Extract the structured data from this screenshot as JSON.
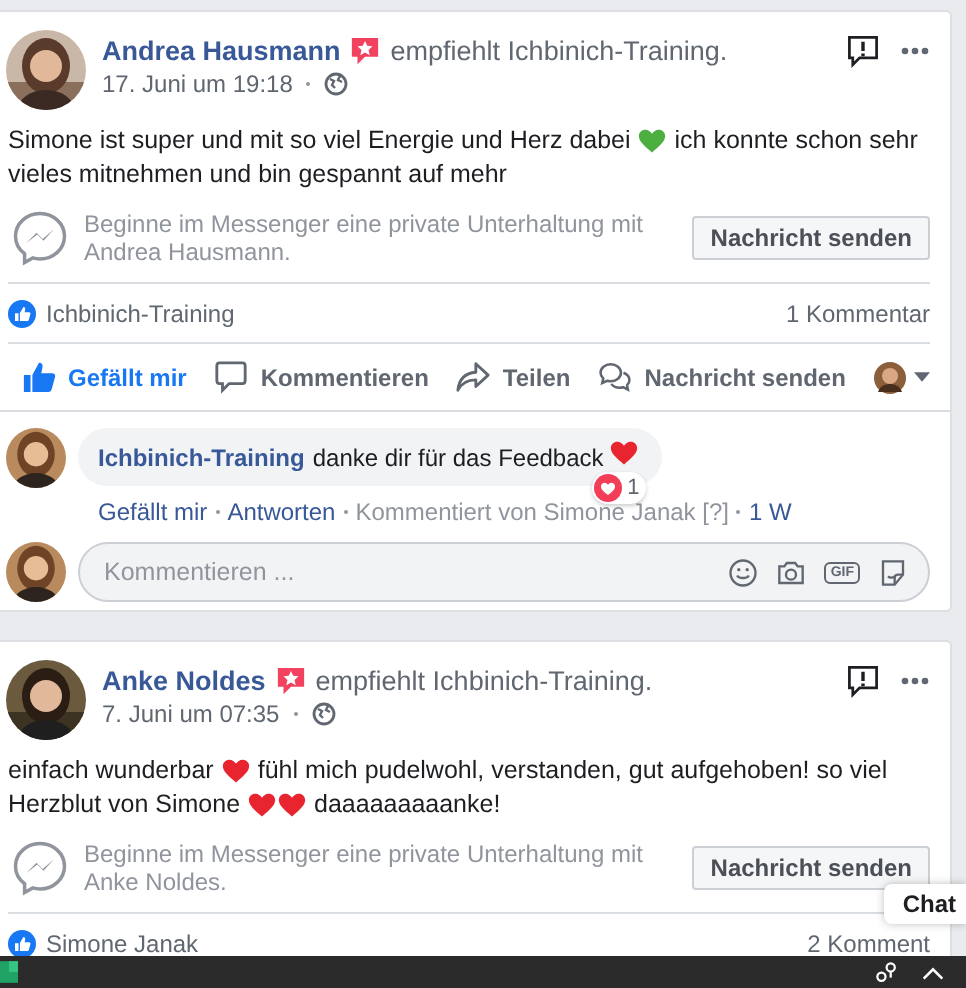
{
  "posts": [
    {
      "author": "Andrea Hausmann",
      "action": "empfiehlt Ichbinich-Training.",
      "time": "17. Juni um 19:18",
      "text": [
        {
          "kind": "text",
          "text": "Simone ist super und mit so viel Energie und Herz dabei"
        },
        {
          "kind": "heart",
          "color": "#4caf3f"
        },
        {
          "kind": "text",
          "text": "ich konnte schon sehr"
        },
        {
          "kind": "text",
          "text": "vieles mitnehmen und bin gespannt auf mehr"
        }
      ],
      "messenger_prompt": "Beginne im Messenger eine private Unterhaltung mit Andrea Hausmann.",
      "message_button": "Nachricht senden",
      "likes": "Ichbinich-Training",
      "comment_count": "1 Kommentar",
      "actions": [
        {
          "kind": "like",
          "label": "Gefällt mir",
          "selected": true
        },
        {
          "kind": "comment",
          "label": "Kommentieren",
          "selected": false
        },
        {
          "kind": "share",
          "label": "Teilen",
          "selected": false
        },
        {
          "kind": "message",
          "label": "Nachricht senden",
          "selected": false
        }
      ],
      "comments": [
        {
          "author": "Ichbinich-Training",
          "text": [
            {
              "kind": "text",
              "text": "danke dir für das Feedback"
            },
            {
              "kind": "heart",
              "color": "#e8242f"
            }
          ],
          "reaction_count": "1",
          "links": [
            "Gefällt mir",
            "Antworten"
          ],
          "attribution": "Kommentiert von Simone Janak [?]",
          "age": "1 W"
        }
      ],
      "composer": {
        "placeholder": "Kommentieren ...",
        "gif_label": "GIF"
      }
    },
    {
      "author": "Anke Noldes",
      "action": "empfiehlt Ichbinich-Training.",
      "time": "7. Juni um 07:35",
      "text": [
        {
          "kind": "text",
          "text": "einfach wunderbar"
        },
        {
          "kind": "heart",
          "color": "#e8242f"
        },
        {
          "kind": "text",
          "text": "fühl mich pudelwohl, verstanden, gut aufgehoben! so viel"
        },
        {
          "kind": "text",
          "text": "Herzblut von Simone"
        },
        {
          "kind": "heart",
          "color": "#e8242f"
        },
        {
          "kind": "heart",
          "color": "#e8242f"
        },
        {
          "kind": "text",
          "text": "daaaaaaaaanke!"
        }
      ],
      "messenger_prompt": "Beginne im Messenger eine private Unterhaltung mit Anke Noldes.",
      "message_button": "Nachricht senden",
      "likes": "Simone Janak",
      "comment_count": "2 Komment"
    }
  ],
  "chat": {
    "label": "Chat"
  }
}
